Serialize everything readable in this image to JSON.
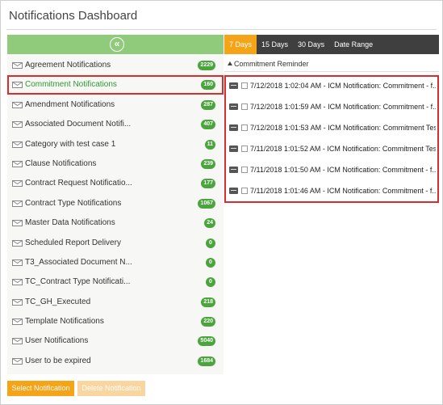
{
  "window": {
    "title": "Notifications Dashboard"
  },
  "left_panel": {
    "collapse_icon": "double-chevron-left-icon",
    "items": [
      {
        "label": "Agreement Notifications",
        "count": "2229"
      },
      {
        "label": "Commitment Notifications",
        "count": "160",
        "selected": true
      },
      {
        "label": "Amendment Notifications",
        "count": "287"
      },
      {
        "label": "Associated Document Notifi...",
        "count": "407"
      },
      {
        "label": "Category with test case 1",
        "count": "11"
      },
      {
        "label": "Clause Notifications",
        "count": "239"
      },
      {
        "label": "Contract Request Notificatio...",
        "count": "177"
      },
      {
        "label": "Contract Type Notifications",
        "count": "1067"
      },
      {
        "label": "Master Data Notifications",
        "count": "24"
      },
      {
        "label": "Scheduled Report Delivery",
        "count": "0"
      },
      {
        "label": "T3_Associated Document N...",
        "count": "0"
      },
      {
        "label": "TC_Contract Type Notificati...",
        "count": "0"
      },
      {
        "label": "TC_GH_Executed",
        "count": "218"
      },
      {
        "label": "Template Notifications",
        "count": "220"
      },
      {
        "label": "User Notifications",
        "count": "5040"
      },
      {
        "label": "User to be expired",
        "count": "1684"
      }
    ]
  },
  "tabs": [
    {
      "label": "7 Days",
      "active": true
    },
    {
      "label": "15 Days"
    },
    {
      "label": "30 Days"
    },
    {
      "label": "Date Range"
    }
  ],
  "group": {
    "label": "Commitment Reminder"
  },
  "messages": [
    {
      "text": "7/12/2018 1:02:04 AM - ICM Notification: Commitment - f..."
    },
    {
      "text": "7/12/2018 1:01:59 AM - ICM Notification: Commitment - f..."
    },
    {
      "text": "7/12/2018 1:01:53 AM - ICM Notification: Commitment Tes..."
    },
    {
      "text": "7/11/2018 1:01:52 AM - ICM Notification: Commitment Tes..."
    },
    {
      "text": "7/11/2018 1:01:50 AM - ICM Notification: Commitment - f..."
    },
    {
      "text": "7/11/2018 1:01:46 AM - ICM Notification: Commitment - f..."
    }
  ],
  "buttons": {
    "select_label": "Select Notification",
    "delete_label": "Delete Notification"
  },
  "colors": {
    "accent_green": "#8fcb7b",
    "badge_green": "#4aa63c",
    "tab_active": "#f5a317",
    "highlight_red": "#d62d2d"
  }
}
